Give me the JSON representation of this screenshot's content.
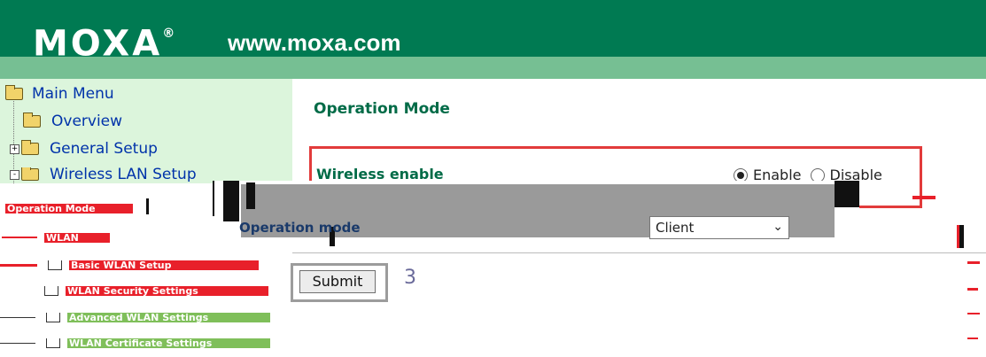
{
  "header": {
    "logo": "MOXA",
    "logo_mark": "®",
    "url": "www.moxa.com"
  },
  "sidebar": {
    "items": [
      {
        "label": "Main Menu",
        "icon": "open-folder-icon"
      },
      {
        "label": "Overview",
        "icon": "folder-icon"
      },
      {
        "label": "General Setup",
        "icon": "folder-icon",
        "expander": "+"
      },
      {
        "label": "Wireless LAN Setup",
        "icon": "folder-icon",
        "expander": "-"
      }
    ],
    "glitched_items": [
      {
        "label": "Operation Mode"
      },
      {
        "label": "WLAN"
      },
      {
        "label": "Basic WLAN Setup"
      },
      {
        "label": "WLAN Security Settings"
      },
      {
        "label": "Advanced WLAN Settings"
      },
      {
        "label": "WLAN Certificate Settings"
      }
    ]
  },
  "main": {
    "title": "Operation Mode",
    "wireless_enable": {
      "label": "Wireless enable",
      "options": [
        "Enable",
        "Disable"
      ],
      "selected": "Enable"
    },
    "operation_mode": {
      "label": "Operation mode",
      "value": "Client"
    },
    "submit_label": "Submit",
    "submit_annotation": "3"
  },
  "colors": {
    "header_green": "#007a52",
    "header_stripe": "#76bf93",
    "sidebar_bg": "#dcf5dc",
    "title_green": "#006b47",
    "link_blue": "#0033aa",
    "highlight_red": "#e23b3b"
  }
}
